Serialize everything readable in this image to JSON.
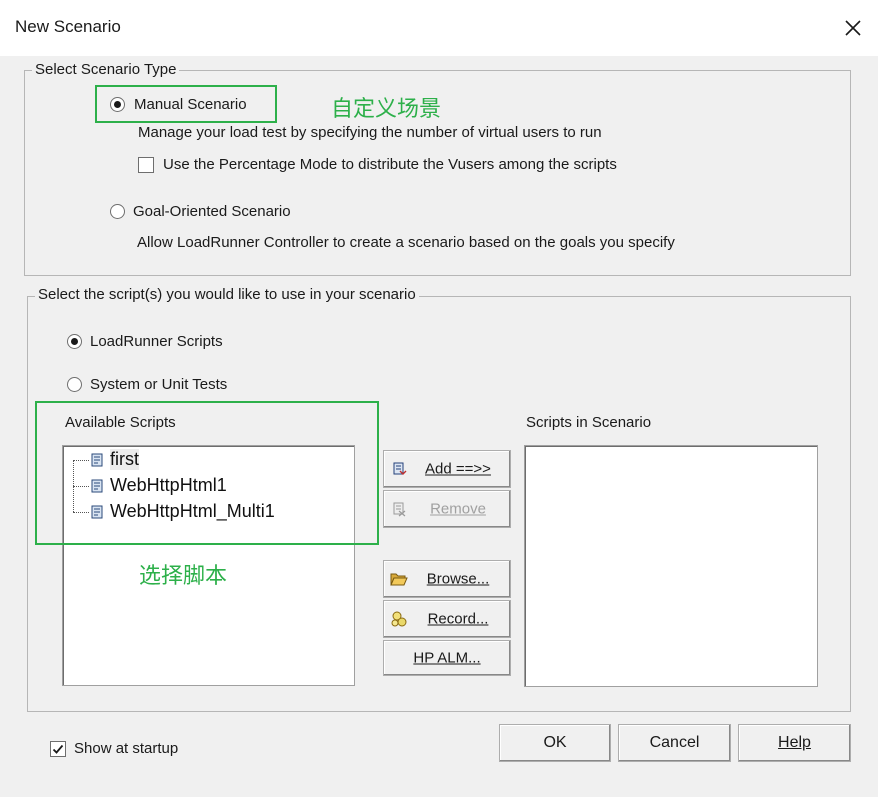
{
  "window": {
    "title": "New Scenario"
  },
  "scenario_type": {
    "legend": "Select Scenario Type",
    "manual": {
      "label": "Manual Scenario",
      "checked": true,
      "description": "Manage your load test by specifying the number of virtual users to run"
    },
    "percentage_mode": {
      "label": "Use the Percentage Mode to distribute the Vusers among the scripts",
      "checked": false
    },
    "goal": {
      "label": "Goal-Oriented Scenario",
      "checked": false,
      "description": "Allow LoadRunner Controller to create a scenario based on the goals you specify"
    }
  },
  "scripts": {
    "legend": "Select the script(s) you would like to use in your scenario",
    "loadrunner": {
      "label": "LoadRunner Scripts",
      "checked": true
    },
    "unit_tests": {
      "label": "System or Unit Tests",
      "checked": false
    },
    "available_label": "Available Scripts",
    "available": [
      "first",
      "WebHttpHtml1",
      "WebHttpHtml_Multi1"
    ],
    "in_scenario_label": "Scripts in Scenario",
    "buttons": {
      "add": "Add ==>>",
      "remove": "Remove",
      "browse": "Browse...",
      "record": "Record...",
      "alm": "HP ALM..."
    }
  },
  "annotations": {
    "manual_note": "自定义场景",
    "select_note": "选择脚本",
    "color": "#2db04a"
  },
  "footer": {
    "show_at_startup": {
      "label": "Show at startup",
      "checked": true
    },
    "ok": "OK",
    "cancel": "Cancel",
    "help": "Help"
  }
}
